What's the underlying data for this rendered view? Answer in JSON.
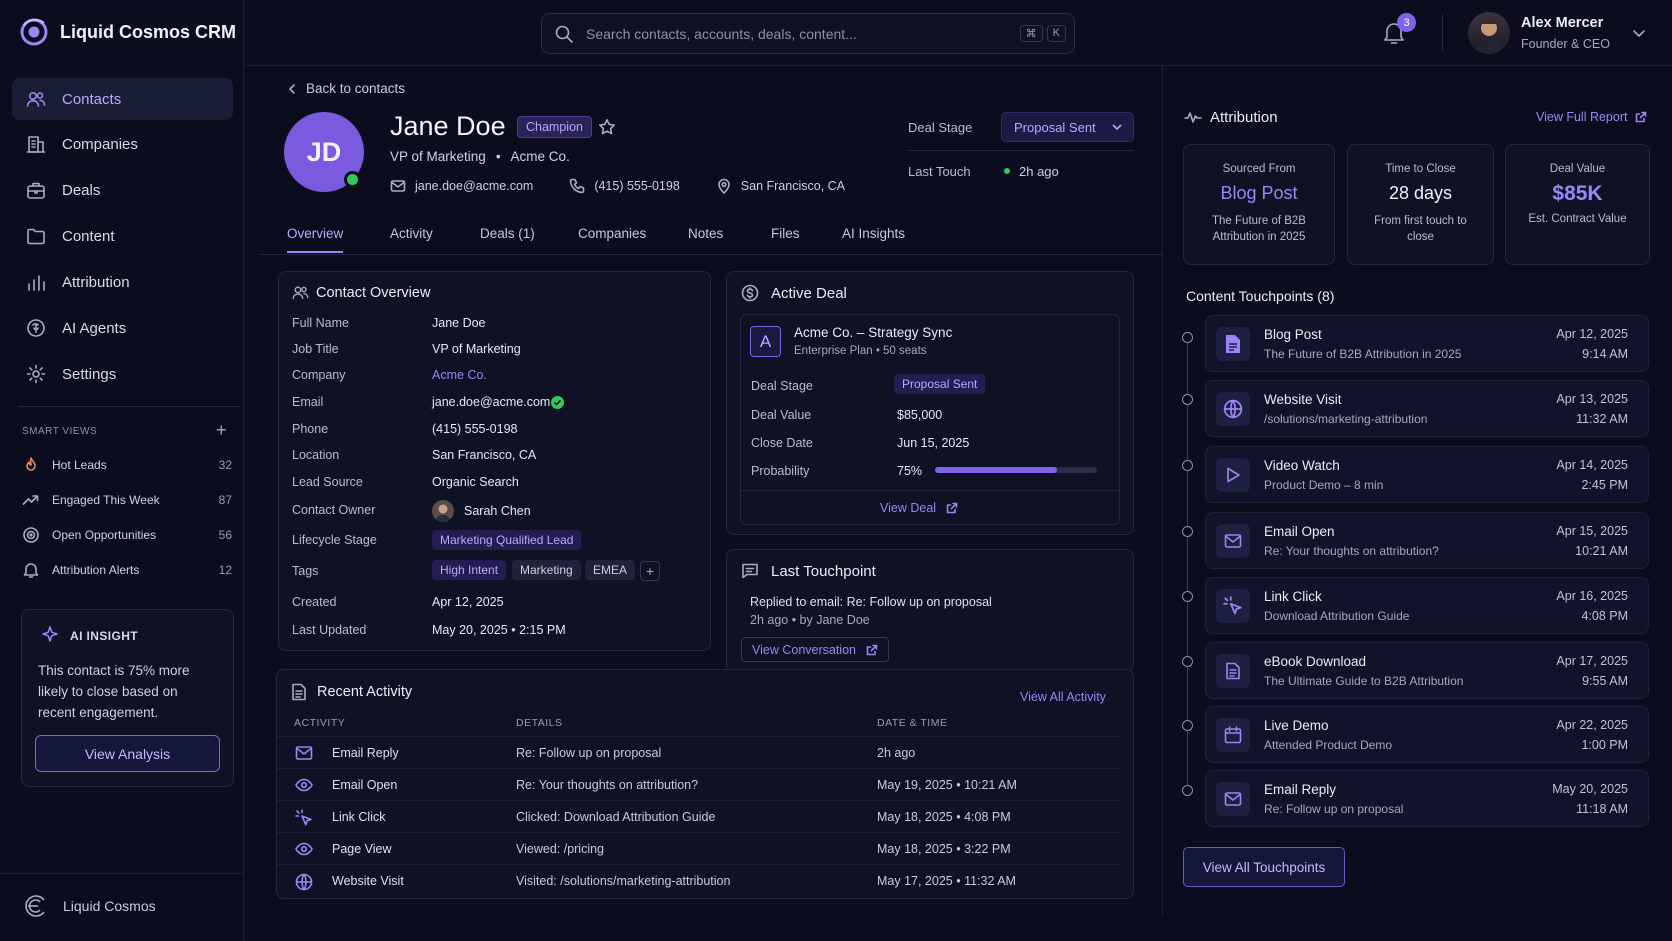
{
  "app": {
    "title": "Liquid Cosmos CRM",
    "footer": "Liquid Cosmos"
  },
  "nav": [
    {
      "label": "Contacts",
      "icon": "users-icon"
    },
    {
      "label": "Companies",
      "icon": "building-icon"
    },
    {
      "label": "Deals",
      "icon": "briefcase-icon"
    },
    {
      "label": "Content",
      "icon": "folder-icon"
    },
    {
      "label": "Attribution",
      "icon": "bar-chart-icon"
    },
    {
      "label": "AI Agents",
      "icon": "brain-icon"
    },
    {
      "label": "Settings",
      "icon": "gear-icon"
    }
  ],
  "smart_views": {
    "heading": "SMART VIEWS",
    "items": [
      {
        "label": "Hot Leads",
        "count": "32"
      },
      {
        "label": "Engaged This Week",
        "count": "87"
      },
      {
        "label": "Open Opportunities",
        "count": "56"
      },
      {
        "label": "Attribution Alerts",
        "count": "12"
      }
    ]
  },
  "ai_insight": {
    "heading": "AI INSIGHT",
    "text": "This contact is 75% more likely to close based on recent engagement.",
    "button": "View Analysis"
  },
  "search": {
    "placeholder": "Search contacts, accounts, deals, content...",
    "kbd1": "⌘",
    "kbd2": "K"
  },
  "notifications": {
    "count": "3"
  },
  "user": {
    "name": "Alex Mercer",
    "role": "Founder & CEO"
  },
  "back": "Back to contacts",
  "contact": {
    "initials": "JD",
    "name": "Jane Doe",
    "badge": "Champion",
    "title_line": "VP of Marketing",
    "company": "Acme Co.",
    "email": "jane.doe@acme.com",
    "phone": "(415) 555-0198",
    "location": "San Francisco, CA"
  },
  "deal_stage": {
    "label": "Deal Stage",
    "value": "Proposal Sent",
    "last_touch_label": "Last Touch",
    "last_touch_value": "2h ago"
  },
  "tabs": [
    "Overview",
    "Activity",
    "Deals (1)",
    "Companies",
    "Notes",
    "Files",
    "AI Insights"
  ],
  "overview": {
    "heading": "Contact Overview",
    "rows": [
      {
        "label": "Full Name",
        "value": "Jane Doe"
      },
      {
        "label": "Job Title",
        "value": "VP of Marketing"
      },
      {
        "label": "Company",
        "value": "Acme Co."
      },
      {
        "label": "Email",
        "value": "jane.doe@acme.com"
      },
      {
        "label": "Phone",
        "value": "(415) 555-0198"
      },
      {
        "label": "Location",
        "value": "San Francisco, CA"
      },
      {
        "label": "Lead Source",
        "value": "Organic Search"
      },
      {
        "label": "Contact Owner",
        "value": "Sarah Chen"
      },
      {
        "label": "Lifecycle Stage",
        "value": "Marketing Qualified Lead"
      },
      {
        "label": "Tags",
        "value": ""
      },
      {
        "label": "Created",
        "value": "Apr 12, 2025"
      },
      {
        "label": "Last Updated",
        "value": "May 20, 2025 • 2:15 PM"
      }
    ],
    "tags": [
      "High Intent",
      "Marketing",
      "EMEA"
    ]
  },
  "active_deal": {
    "heading": "Active Deal",
    "logo": "A",
    "name": "Acme Co. – Strategy Sync",
    "plan": "Enterprise Plan • 50 seats",
    "rows": [
      {
        "label": "Deal Stage",
        "value": "Proposal Sent"
      },
      {
        "label": "Deal Value",
        "value": "$85,000"
      },
      {
        "label": "Close Date",
        "value": "Jun 15, 2025"
      },
      {
        "label": "Probability",
        "value": "75%"
      }
    ],
    "probability": 0.75,
    "link": "View Deal"
  },
  "last_touchpoint": {
    "heading": "Last Touchpoint",
    "text": "Replied to email: Re: Follow up on proposal",
    "meta": "2h ago • by Jane Doe",
    "button": "View Conversation"
  },
  "recent_activity": {
    "heading": "Recent Activity",
    "link": "View All Activity",
    "columns": [
      "ACTIVITY",
      "DETAILS",
      "DATE & TIME"
    ],
    "rows": [
      {
        "activity": "Email Reply",
        "details": "Re: Follow up on proposal",
        "date": "2h ago",
        "icon": "mail-icon"
      },
      {
        "activity": "Email Open",
        "details": "Re: Your thoughts on attribution?",
        "date": "May 19, 2025 • 10:21 AM",
        "icon": "eye-icon"
      },
      {
        "activity": "Link Click",
        "details": "Clicked: Download Attribution Guide",
        "date": "May 18, 2025 • 4:08 PM",
        "icon": "cursor-icon"
      },
      {
        "activity": "Page View",
        "details": "Viewed: /pricing",
        "date": "May 18, 2025 • 3:22 PM",
        "icon": "eye-icon"
      },
      {
        "activity": "Website Visit",
        "details": "Visited: /solutions/marketing-attribution",
        "date": "May 17, 2025 • 11:32 AM",
        "icon": "globe-icon"
      }
    ]
  },
  "attribution": {
    "heading": "Attribution",
    "link": "View Full Report",
    "cards": [
      {
        "label": "Sourced From",
        "value": "Blog Post",
        "sub": "The Future of B2B Attribution in 2025"
      },
      {
        "label": "Time to Close",
        "value": "28 days",
        "sub": "From first touch to close"
      },
      {
        "label": "Deal Value",
        "value": "$85K",
        "sub": "Est. Contract Value"
      }
    ]
  },
  "touchpoints": {
    "heading": "Content Touchpoints (8)",
    "button": "View All Touchpoints",
    "items": [
      {
        "title": "Blog Post",
        "sub": "The Future of B2B Attribution in 2025",
        "date": "Apr 12, 2025",
        "time": "9:14 AM",
        "icon": "document-icon"
      },
      {
        "title": "Website Visit",
        "sub": "/solutions/marketing-attribution",
        "date": "Apr 13, 2025",
        "time": "11:32 AM",
        "icon": "globe-icon"
      },
      {
        "title": "Video Watch",
        "sub": "Product Demo – 8 min",
        "date": "Apr 14, 2025",
        "time": "2:45 PM",
        "icon": "play-icon"
      },
      {
        "title": "Email Open",
        "sub": "Re: Your thoughts on attribution?",
        "date": "Apr 15, 2025",
        "time": "10:21 AM",
        "icon": "mail-icon"
      },
      {
        "title": "Link Click",
        "sub": "Download Attribution Guide",
        "date": "Apr 16, 2025",
        "time": "4:08 PM",
        "icon": "cursor-icon"
      },
      {
        "title": "eBook Download",
        "sub": "The Ultimate Guide to B2B Attribution",
        "date": "Apr 17, 2025",
        "time": "9:55 AM",
        "icon": "document-icon"
      },
      {
        "title": "Live Demo",
        "sub": "Attended Product Demo",
        "date": "Apr 22, 2025",
        "time": "1:00 PM",
        "icon": "calendar-icon"
      },
      {
        "title": "Email Reply",
        "sub": "Re: Follow up on proposal",
        "date": "May 20, 2025",
        "time": "11:18 AM",
        "icon": "mail-icon"
      }
    ]
  },
  "colors": {
    "accent": "#9b86f5",
    "background": "#0b0d1e",
    "online": "#34c759"
  }
}
